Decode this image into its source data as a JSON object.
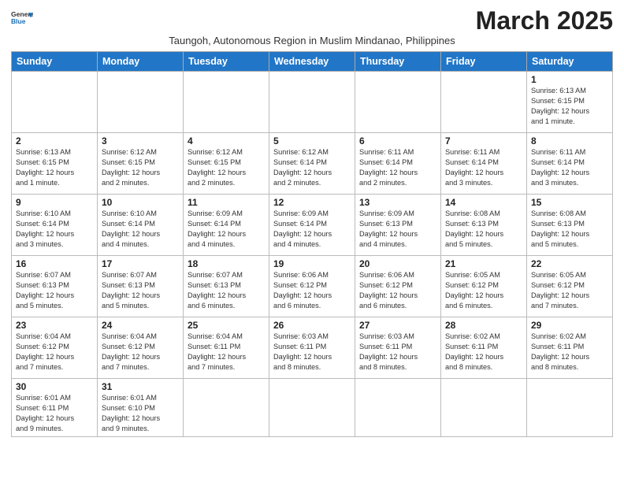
{
  "header": {
    "logo_general": "General",
    "logo_blue": "Blue",
    "month_title": "March 2025",
    "subtitle": "Taungoh, Autonomous Region in Muslim Mindanao, Philippines"
  },
  "weekdays": [
    "Sunday",
    "Monday",
    "Tuesday",
    "Wednesday",
    "Thursday",
    "Friday",
    "Saturday"
  ],
  "days": {
    "d1": {
      "num": "1",
      "info": "Sunrise: 6:13 AM\nSunset: 6:15 PM\nDaylight: 12 hours\nand 1 minute."
    },
    "d2": {
      "num": "2",
      "info": "Sunrise: 6:13 AM\nSunset: 6:15 PM\nDaylight: 12 hours\nand 1 minute."
    },
    "d3": {
      "num": "3",
      "info": "Sunrise: 6:12 AM\nSunset: 6:15 PM\nDaylight: 12 hours\nand 2 minutes."
    },
    "d4": {
      "num": "4",
      "info": "Sunrise: 6:12 AM\nSunset: 6:15 PM\nDaylight: 12 hours\nand 2 minutes."
    },
    "d5": {
      "num": "5",
      "info": "Sunrise: 6:12 AM\nSunset: 6:14 PM\nDaylight: 12 hours\nand 2 minutes."
    },
    "d6": {
      "num": "6",
      "info": "Sunrise: 6:11 AM\nSunset: 6:14 PM\nDaylight: 12 hours\nand 2 minutes."
    },
    "d7": {
      "num": "7",
      "info": "Sunrise: 6:11 AM\nSunset: 6:14 PM\nDaylight: 12 hours\nand 3 minutes."
    },
    "d8": {
      "num": "8",
      "info": "Sunrise: 6:11 AM\nSunset: 6:14 PM\nDaylight: 12 hours\nand 3 minutes."
    },
    "d9": {
      "num": "9",
      "info": "Sunrise: 6:10 AM\nSunset: 6:14 PM\nDaylight: 12 hours\nand 3 minutes."
    },
    "d10": {
      "num": "10",
      "info": "Sunrise: 6:10 AM\nSunset: 6:14 PM\nDaylight: 12 hours\nand 4 minutes."
    },
    "d11": {
      "num": "11",
      "info": "Sunrise: 6:09 AM\nSunset: 6:14 PM\nDaylight: 12 hours\nand 4 minutes."
    },
    "d12": {
      "num": "12",
      "info": "Sunrise: 6:09 AM\nSunset: 6:14 PM\nDaylight: 12 hours\nand 4 minutes."
    },
    "d13": {
      "num": "13",
      "info": "Sunrise: 6:09 AM\nSunset: 6:13 PM\nDaylight: 12 hours\nand 4 minutes."
    },
    "d14": {
      "num": "14",
      "info": "Sunrise: 6:08 AM\nSunset: 6:13 PM\nDaylight: 12 hours\nand 5 minutes."
    },
    "d15": {
      "num": "15",
      "info": "Sunrise: 6:08 AM\nSunset: 6:13 PM\nDaylight: 12 hours\nand 5 minutes."
    },
    "d16": {
      "num": "16",
      "info": "Sunrise: 6:07 AM\nSunset: 6:13 PM\nDaylight: 12 hours\nand 5 minutes."
    },
    "d17": {
      "num": "17",
      "info": "Sunrise: 6:07 AM\nSunset: 6:13 PM\nDaylight: 12 hours\nand 5 minutes."
    },
    "d18": {
      "num": "18",
      "info": "Sunrise: 6:07 AM\nSunset: 6:13 PM\nDaylight: 12 hours\nand 6 minutes."
    },
    "d19": {
      "num": "19",
      "info": "Sunrise: 6:06 AM\nSunset: 6:12 PM\nDaylight: 12 hours\nand 6 minutes."
    },
    "d20": {
      "num": "20",
      "info": "Sunrise: 6:06 AM\nSunset: 6:12 PM\nDaylight: 12 hours\nand 6 minutes."
    },
    "d21": {
      "num": "21",
      "info": "Sunrise: 6:05 AM\nSunset: 6:12 PM\nDaylight: 12 hours\nand 6 minutes."
    },
    "d22": {
      "num": "22",
      "info": "Sunrise: 6:05 AM\nSunset: 6:12 PM\nDaylight: 12 hours\nand 7 minutes."
    },
    "d23": {
      "num": "23",
      "info": "Sunrise: 6:04 AM\nSunset: 6:12 PM\nDaylight: 12 hours\nand 7 minutes."
    },
    "d24": {
      "num": "24",
      "info": "Sunrise: 6:04 AM\nSunset: 6:12 PM\nDaylight: 12 hours\nand 7 minutes."
    },
    "d25": {
      "num": "25",
      "info": "Sunrise: 6:04 AM\nSunset: 6:11 PM\nDaylight: 12 hours\nand 7 minutes."
    },
    "d26": {
      "num": "26",
      "info": "Sunrise: 6:03 AM\nSunset: 6:11 PM\nDaylight: 12 hours\nand 8 minutes."
    },
    "d27": {
      "num": "27",
      "info": "Sunrise: 6:03 AM\nSunset: 6:11 PM\nDaylight: 12 hours\nand 8 minutes."
    },
    "d28": {
      "num": "28",
      "info": "Sunrise: 6:02 AM\nSunset: 6:11 PM\nDaylight: 12 hours\nand 8 minutes."
    },
    "d29": {
      "num": "29",
      "info": "Sunrise: 6:02 AM\nSunset: 6:11 PM\nDaylight: 12 hours\nand 8 minutes."
    },
    "d30": {
      "num": "30",
      "info": "Sunrise: 6:01 AM\nSunset: 6:11 PM\nDaylight: 12 hours\nand 9 minutes."
    },
    "d31": {
      "num": "31",
      "info": "Sunrise: 6:01 AM\nSunset: 6:10 PM\nDaylight: 12 hours\nand 9 minutes."
    }
  }
}
